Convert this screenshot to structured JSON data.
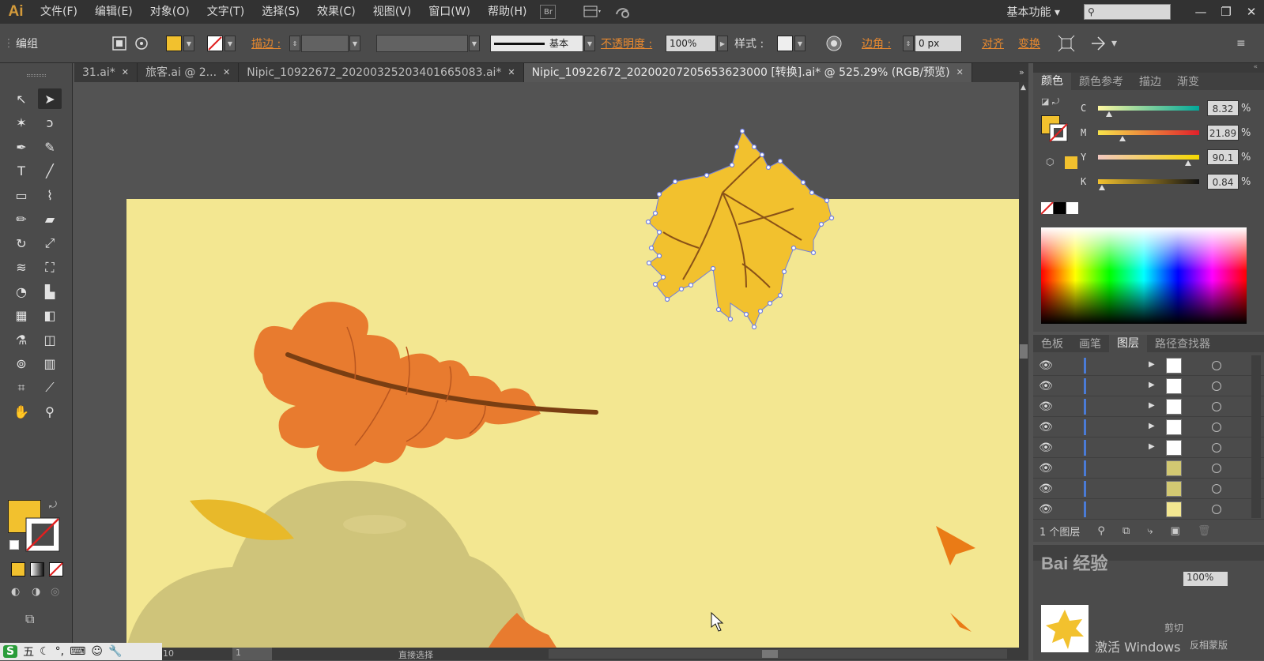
{
  "app": {
    "logo": "Ai",
    "workspace": "基本功能"
  },
  "menu": [
    "文件(F)",
    "编辑(E)",
    "对象(O)",
    "文字(T)",
    "选择(S)",
    "效果(C)",
    "视图(V)",
    "窗口(W)",
    "帮助(H)"
  ],
  "menubar_icons": {
    "bridge": "Br",
    "arrange": "arrange-documents-icon",
    "sync": "sync-icon"
  },
  "search": {
    "icon": "⚲"
  },
  "window_controls": {
    "minimize": "—",
    "restore": "❐",
    "close": "✕"
  },
  "control": {
    "selection_label": "编组",
    "stroke_label": "描边 :",
    "stroke_profile": "基本",
    "opacity_label": "不透明度 :",
    "opacity_value": "100%",
    "style_label": "样式 :",
    "corner_label": "边角 :",
    "corner_value": "0 px",
    "align_label": "对齐",
    "transform_label": "变换"
  },
  "tabs": [
    {
      "label": "31.ai*",
      "close": "✕"
    },
    {
      "label": "旅客.ai @ 2...",
      "close": "✕"
    },
    {
      "label": "Nipic_10922672_20200325203401665083.ai*",
      "close": "✕"
    },
    {
      "label": "Nipic_10922672_20200207205653623000 [转换].ai* @ 525.29% (RGB/预览)",
      "close": "✕"
    }
  ],
  "tools": [
    {
      "name": "selection-tool",
      "glyph": "↖"
    },
    {
      "name": "direct-selection-tool",
      "glyph": "➤"
    },
    {
      "name": "magic-wand-tool",
      "glyph": "✶"
    },
    {
      "name": "lasso-tool",
      "glyph": "ↄ"
    },
    {
      "name": "pen-tool",
      "glyph": "✒"
    },
    {
      "name": "curvature-tool",
      "glyph": "✎"
    },
    {
      "name": "type-tool",
      "glyph": "T"
    },
    {
      "name": "line-tool",
      "glyph": "╱"
    },
    {
      "name": "rectangle-tool",
      "glyph": "▭"
    },
    {
      "name": "paintbrush-tool",
      "glyph": "⌇"
    },
    {
      "name": "pencil-tool",
      "glyph": "✏"
    },
    {
      "name": "eraser-tool",
      "glyph": "▰"
    },
    {
      "name": "rotate-tool",
      "glyph": "↻"
    },
    {
      "name": "scale-tool",
      "glyph": "⤢"
    },
    {
      "name": "width-tool",
      "glyph": "≋"
    },
    {
      "name": "free-transform-tool",
      "glyph": "⛶"
    },
    {
      "name": "shape-builder-tool",
      "glyph": "◔"
    },
    {
      "name": "graph-column-tool",
      "glyph": "▙"
    },
    {
      "name": "mesh-tool",
      "glyph": "▦"
    },
    {
      "name": "gradient-tool",
      "glyph": "◧"
    },
    {
      "name": "eyedropper-tool",
      "glyph": "⚗"
    },
    {
      "name": "blend-tool",
      "glyph": "◫"
    },
    {
      "name": "symbol-sprayer-tool",
      "glyph": "⊚"
    },
    {
      "name": "column-graph-tool",
      "glyph": "▥"
    },
    {
      "name": "artboard-tool",
      "glyph": "⌗"
    },
    {
      "name": "slice-tool",
      "glyph": "⟋"
    },
    {
      "name": "hand-tool",
      "glyph": "✋"
    },
    {
      "name": "zoom-tool",
      "glyph": "⚲"
    }
  ],
  "color_panel": {
    "tabs": [
      "颜色",
      "颜色参考",
      "描边",
      "渐变"
    ],
    "channels": [
      {
        "label": "C",
        "value": "8.32",
        "fraction": 0.08,
        "gradient": "linear-gradient(90deg,#fff7a0,#00a89a)"
      },
      {
        "label": "M",
        "value": "21.89",
        "fraction": 0.22,
        "gradient": "linear-gradient(90deg,#f7e24a,#e0202a)"
      },
      {
        "label": "Y",
        "value": "90.1",
        "fraction": 0.9,
        "gradient": "linear-gradient(90deg,#f2c8c0,#f5d800)"
      },
      {
        "label": "K",
        "value": "0.84",
        "fraction": 0.01,
        "gradient": "linear-gradient(90deg,#f2c12e,#111)"
      }
    ],
    "pct": "%",
    "fill_color": "#f2c12e"
  },
  "layers_panel": {
    "tabs": [
      "色板",
      "画笔",
      "图层",
      "路径查找器"
    ],
    "footer_label": "1 个图层",
    "rows": [
      {
        "thumb": "leaf",
        "has_arrow": true
      },
      {
        "thumb": "leaf",
        "has_arrow": true
      },
      {
        "thumb": "leaf",
        "has_arrow": true
      },
      {
        "thumb": "leaf",
        "has_arrow": true
      },
      {
        "thumb": "leaf",
        "has_arrow": true
      },
      {
        "thumb": "olive",
        "has_arrow": false
      },
      {
        "thumb": "olive",
        "has_arrow": false
      },
      {
        "thumb": "yellow",
        "has_arrow": false
      }
    ]
  },
  "navigator": {
    "zoom": "100%",
    "watermark": "Bai 经验",
    "activate": "激活 Windows",
    "cut": "剪切",
    "version": "反相蒙版"
  },
  "status": {
    "zoom": "10",
    "page": "1",
    "tool": "直接选择"
  },
  "ime": {
    "logo": "S",
    "mode": "五"
  },
  "colors": {
    "artboard": "#f3e791",
    "accent": "#e8892f",
    "selection": "#6f7ee0"
  }
}
